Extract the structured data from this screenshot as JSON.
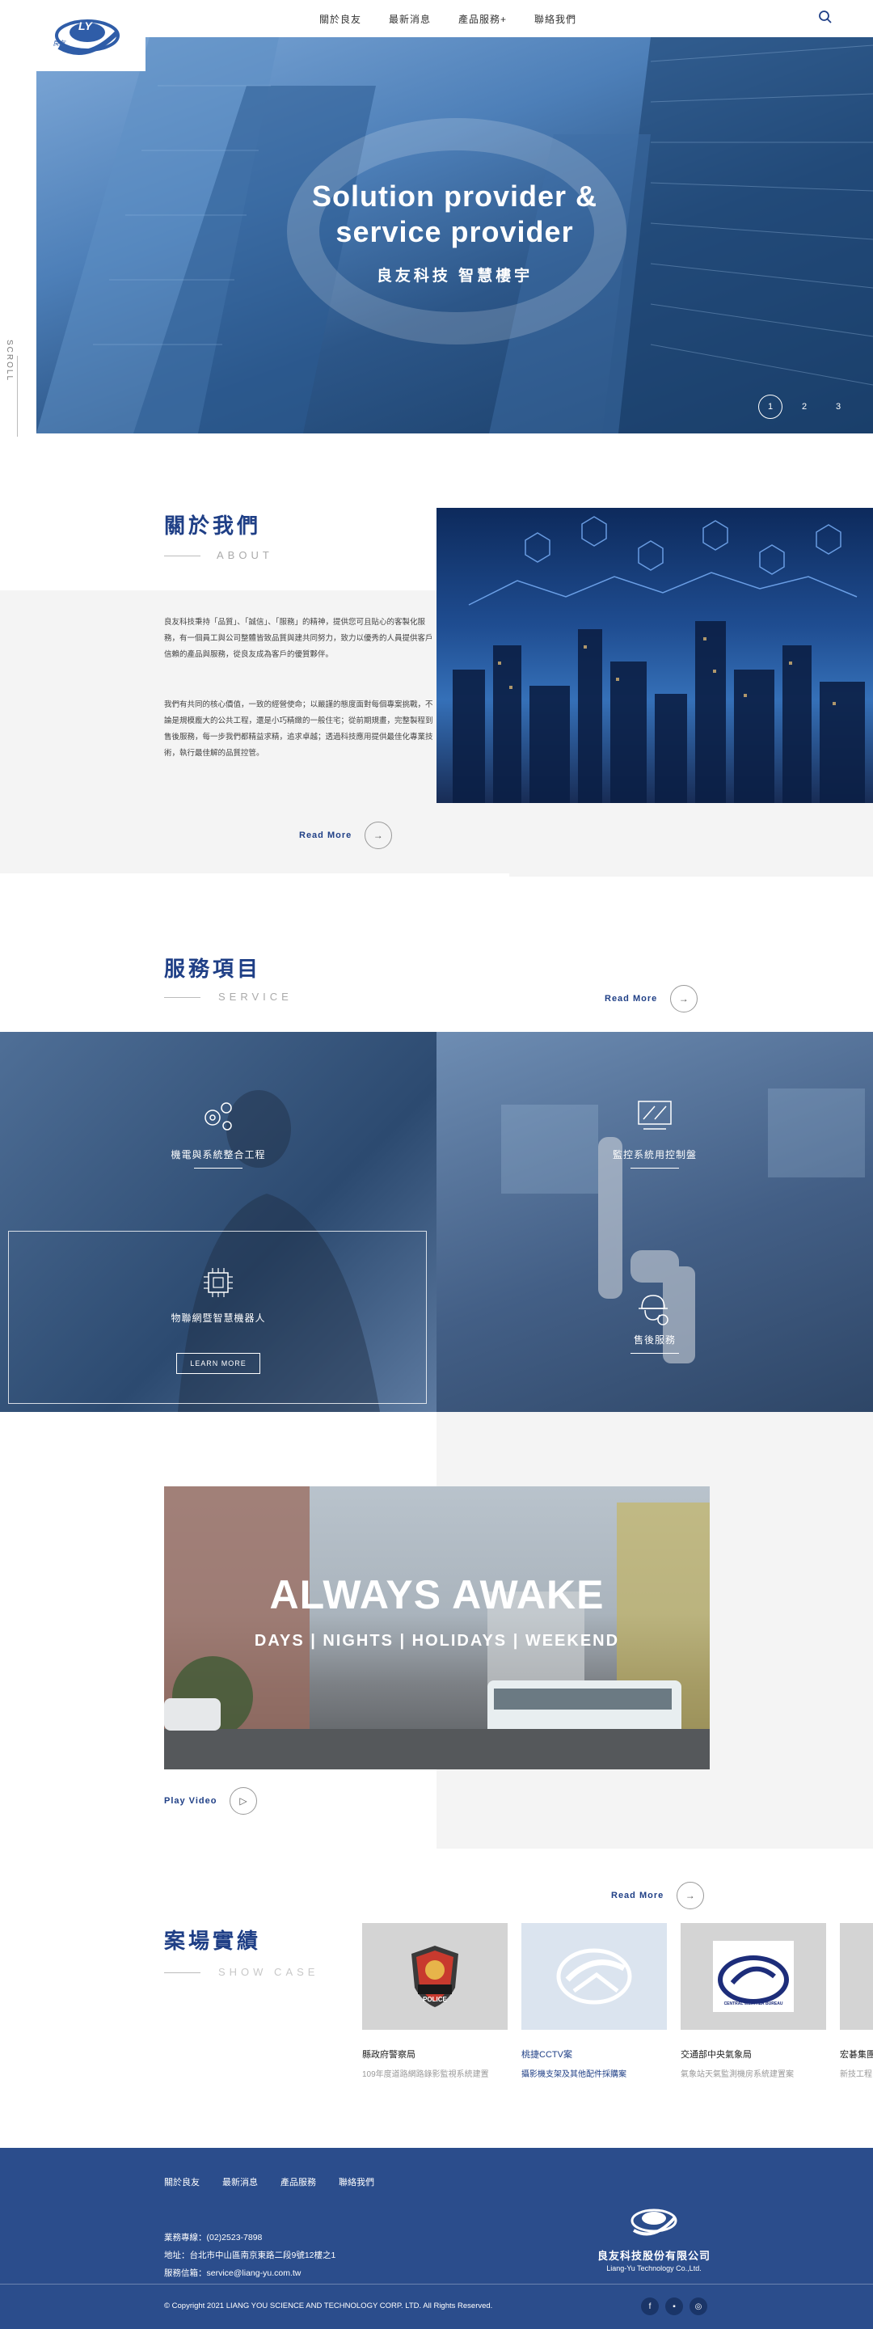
{
  "nav": {
    "items": [
      "關於良友",
      "最新消息",
      "產品服務+",
      "聯絡我們"
    ]
  },
  "logo": {
    "letters": "LY",
    "small": "良友"
  },
  "hero": {
    "title_line1": "Solution provider &",
    "title_line2": "service provider",
    "subtitle": "良友科技  智慧樓宇",
    "slides": [
      "1",
      "2",
      "3"
    ],
    "scroll_label": "SCROLL"
  },
  "about": {
    "title": "關於我們",
    "subtitle": "ABOUT",
    "para1": "良友科技秉持「品質」、「誠信」、「服務」的精神，提供您可且貼心的客製化服務，有一個員工與公司整體皆致品質與建共同努力，致力以優秀的人員提供客戶信賴的產品與服務，從良友成為客戶的優質夥伴。",
    "para2": "我們有共同的核心價值，一致的經營使命；以嚴謹的態度面對每個專案挑戰，不論是規模龐大的公共工程，還是小巧精緻的一般住宅；從前期規畫，完整製程到售後服務，每一步我們都精益求精，追求卓越；透過科技應用提供最佳化專業技術，執行最佳解的品質控管。",
    "readmore": "Read More"
  },
  "service": {
    "title": "服務項目",
    "subtitle": "SERVICE",
    "readmore": "Read More",
    "items": [
      "機電與系統整合工程",
      "監控系統用控制盤",
      "物聯網暨智慧機器人",
      "售後服務"
    ],
    "learn_more": "LEARN MORE"
  },
  "video": {
    "title": "ALWAYS AWAKE",
    "subtitle": "DAYS | NIGHTS | HOLIDAYS | WEEKEND",
    "play_label": "Play Video"
  },
  "cases": {
    "title": "案場實績",
    "subtitle": "SHOW CASE",
    "readmore": "Read More",
    "items": [
      {
        "title": "縣政府警察局",
        "desc": "109年度道路網路錄影監視系統建置",
        "badge": "POLICE"
      },
      {
        "title": "桃捷CCTV案",
        "desc": "攝影機支架及其他配件採購案",
        "badge": ""
      },
      {
        "title": "交通部中央氣象局",
        "desc": "氣象站天氣監測機房系統建置案",
        "badge": "CENTRAL WEATHER BUREAU"
      },
      {
        "title": "宏碁集團",
        "desc": "新技工程",
        "badge": ""
      }
    ]
  },
  "footer": {
    "nav": [
      "關於良友",
      "最新消息",
      "產品服務",
      "聯絡我們"
    ],
    "phone": "業務專線：(02)2523-7898",
    "address": "地址：台北市中山區南京東路二段9號12樓之1",
    "email": "服務信箱：service@liang-yu.com.tw",
    "company": "良友科技股份有限公司",
    "company_en": "Liang-Yu Technology Co.,Ltd.",
    "copyright": "© Copyright 2021 LIANG YOU SCIENCE AND TECHNOLOGY CORP. LTD. All Rights Reserved."
  },
  "colors": {
    "brand": "#1f3f86",
    "footer": "#2b4d8c",
    "service_overlay": "#3a5a82"
  }
}
